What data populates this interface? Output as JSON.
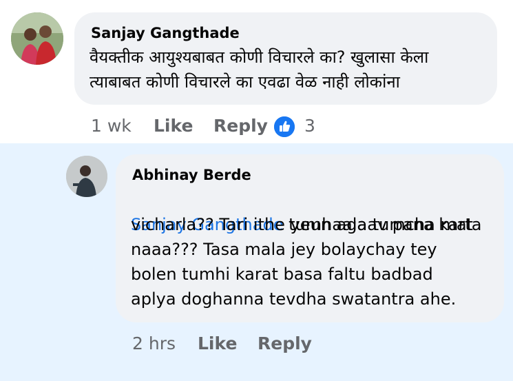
{
  "comment": {
    "author": "Sanjay Gangthade",
    "text_line1": "वैयक्तीक आयुश्यबाबत कोणी विचारले का?  खुलासा केला",
    "text_line2": "त्याबाबत कोणी विचारले का एवढा वेळ नाही लोकांना",
    "time": "1 wk",
    "like_label": "Like",
    "reply_label": "Reply",
    "reaction_count": "3",
    "reaction_icon": "thumbs-up-icon",
    "reaction_color": "#1877f2"
  },
  "reply": {
    "author": "Abhinay Berde",
    "mention": "Sanjay Gangthade",
    "line1_rest": " tumhaala tumcha mat",
    "line2": "vicharla?? Tari ithe yeun agaav pana karta",
    "line3": "naaa??? Tasa mala jey bolaychay tey",
    "line4": "bolen tumhi karat basa faltu badbad",
    "line5": "aplya doghanna tevdha swatantra ahe.",
    "time": "2 hrs",
    "like_label": "Like",
    "reply_label": "Reply"
  },
  "colors": {
    "bubble": "#f0f2f5",
    "highlight_band": "#e7f3ff",
    "mention": "#1b74e4",
    "meta": "#65676b"
  }
}
